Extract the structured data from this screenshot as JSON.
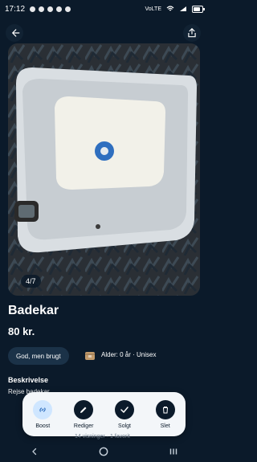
{
  "status": {
    "time": "17:12",
    "network": "VoLTE",
    "battery_level": 0.8
  },
  "product": {
    "image_counter": "4/7",
    "title": "Badekar",
    "price": "80 kr.",
    "condition": "God, men brugt",
    "meta": "Alder: 0 år · Unisex",
    "description_title": "Beskrivelse",
    "description_text": "Rejse badekar"
  },
  "actions": {
    "boost": "Boost",
    "edit": "Rediger",
    "sold": "Solgt",
    "delete": "Slet"
  },
  "stats": {
    "views": "14 visninger · 1 favorit"
  },
  "colors": {
    "background": "#0b1a2a",
    "panel": "#f3f6f9",
    "chip": "#1b3248",
    "accent_blue": "#2f6fbf",
    "boost_bg": "#cfe6ff"
  },
  "icons": [
    "back-arrow-icon",
    "share-icon",
    "link-icon",
    "pencil-icon",
    "check-icon",
    "trash-icon",
    "nav-back-icon",
    "nav-home-icon",
    "nav-recents-icon"
  ]
}
